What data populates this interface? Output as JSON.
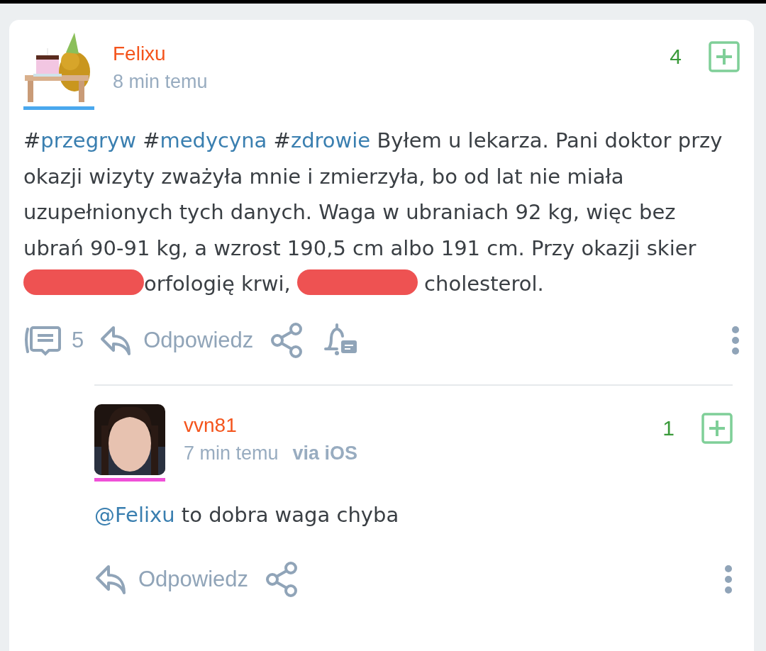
{
  "post": {
    "author": {
      "name": "Felixu",
      "color": "#4aa8ee"
    },
    "time": "8 min temu",
    "votes": "4",
    "body": [
      {
        "kind": "tag",
        "hash": "#",
        "text": "przegryw"
      },
      {
        "kind": "tag",
        "hash": "#",
        "text": "medycyna"
      },
      {
        "kind": "tag",
        "hash": "#",
        "text": "zdrowie"
      },
      {
        "kind": "text",
        "text": " Byłem u lekarza. Pani doktor przy okazji wizyty zważyła mnie i zmierzyła, bo od lat nie miała uzupełnionych tych danych. Waga w ubraniach 92 kg, więc bez ubrań 90-91 kg, a wzrost 190,5 cm albo 191 cm. Przy okazji skier"
      },
      {
        "kind": "redaction"
      },
      {
        "kind": "text",
        "text": "orfologię krwi, "
      },
      {
        "kind": "redaction"
      },
      {
        "kind": "text",
        "text": " cholesterol."
      }
    ],
    "comments_count": "5",
    "reply_label": "Odpowiedz"
  },
  "comment": {
    "author": {
      "name": "vvn81",
      "color": "#f050d8"
    },
    "time": "7 min temu",
    "via": "via iOS",
    "votes": "1",
    "body": [
      {
        "kind": "mention",
        "text": "@Felixu"
      },
      {
        "kind": "text",
        "text": " to dobra waga chyba"
      }
    ],
    "reply_label": "Odpowiedz"
  }
}
